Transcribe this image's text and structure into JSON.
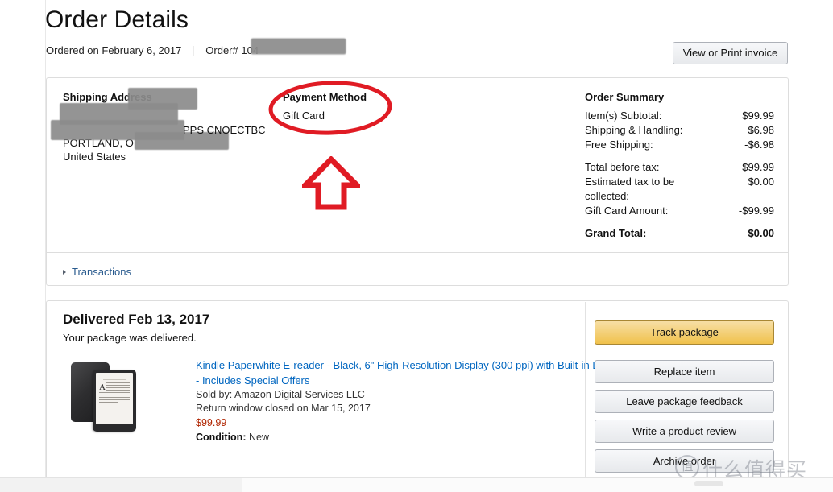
{
  "header": {
    "title": "Order Details",
    "ordered_on": "Ordered on February 6, 2017",
    "order_number": "Order# 104",
    "invoice_button": "View or Print invoice"
  },
  "shipping": {
    "heading": "Shipping Address",
    "line_visible_1": "PPS CNOECTBC",
    "line_visible_2": "PORTLAND, O",
    "line_visible_3": "United States"
  },
  "payment": {
    "heading": "Payment Method",
    "value": "Gift Card"
  },
  "order_summary": {
    "heading": "Order Summary",
    "rows": [
      {
        "label": "Item(s) Subtotal:",
        "value": "$99.99"
      },
      {
        "label": "Shipping & Handling:",
        "value": "$6.98"
      },
      {
        "label": "Free Shipping:",
        "value": "-$6.98"
      },
      {
        "label": "Total before tax:",
        "value": "$99.99"
      },
      {
        "label": "Estimated tax to be collected:",
        "value": "$0.00"
      },
      {
        "label": "Gift Card Amount:",
        "value": "-$99.99"
      },
      {
        "label": "Grand Total:",
        "value": "$0.00"
      }
    ]
  },
  "transactions": {
    "label": "Transactions"
  },
  "shipment": {
    "status_title": "Delivered Feb 13, 2017",
    "status_sub": "Your package was delivered.",
    "product_title": "Kindle Paperwhite E-reader - Black, 6\" High-Resolution Display (300 ppi) with Built-in Light, Wi-Fi - Includes Special Offers",
    "sold_by": "Sold by: Amazon Digital Services LLC",
    "return_window": "Return window closed on Mar 15, 2017",
    "price": "$99.99",
    "condition_label": "Condition:",
    "condition_value": "New",
    "buttons": [
      "Track package",
      "Replace item",
      "Leave package feedback",
      "Write a product review",
      "Archive order"
    ]
  },
  "annotations": {
    "ellipse_color": "#e01b24",
    "arrow_color": "#e01b24"
  },
  "watermark": {
    "logo_glyph": "值",
    "text": "什么值得买"
  }
}
